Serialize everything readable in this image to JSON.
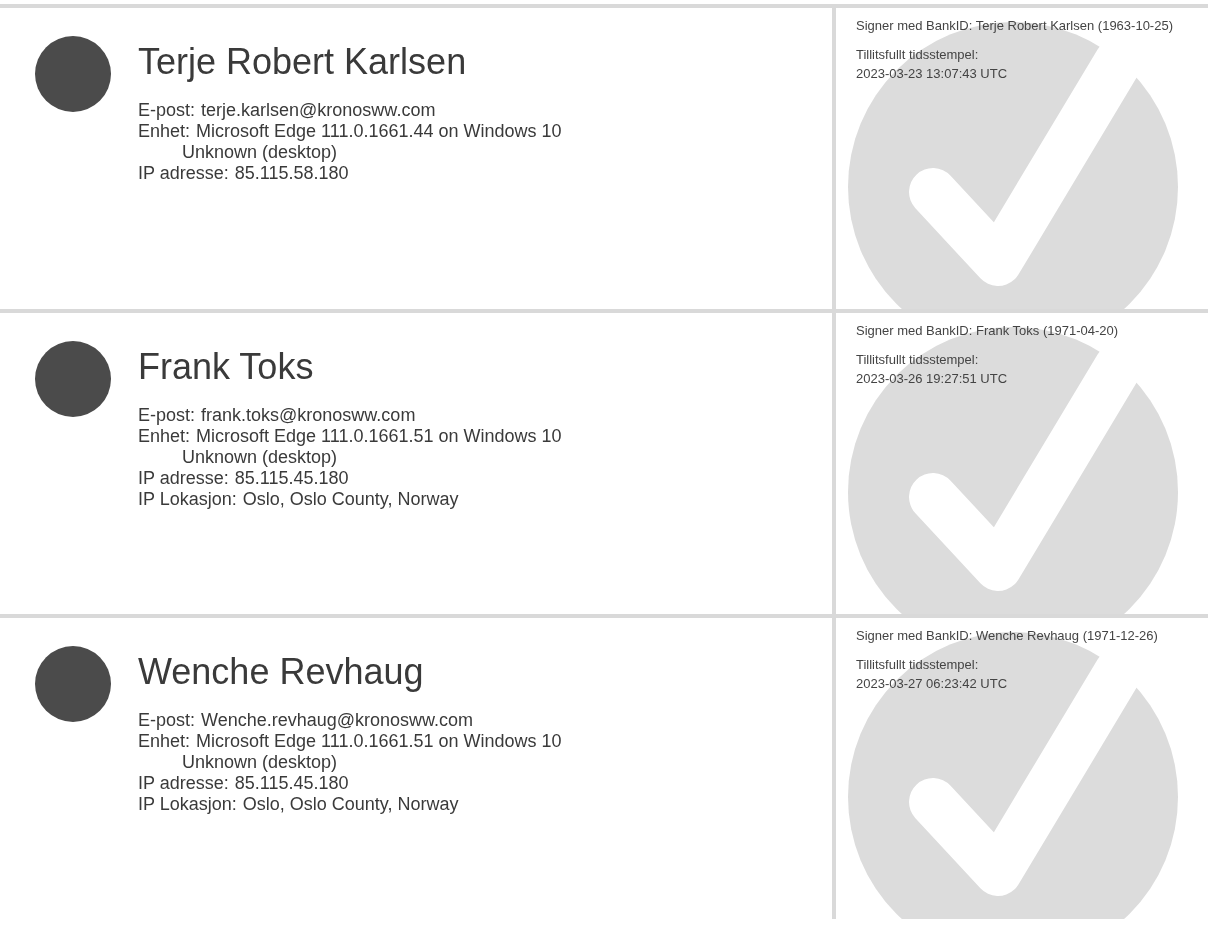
{
  "signers": [
    {
      "name": "Terje Robert Karlsen",
      "fields": [
        {
          "label": "E-post:",
          "value_lines": [
            "terje.karlsen@kronosww.com"
          ]
        },
        {
          "label": "Enhet:",
          "value_lines": [
            "Microsoft Edge 111.0.1661.44 on Windows 10",
            "Unknown (desktop)"
          ]
        },
        {
          "label": "IP adresse:",
          "value_lines": [
            "85.115.58.180"
          ]
        }
      ],
      "signature": "Signer med BankID: Terje Robert Karlsen (1963-10-25)",
      "timestamp_label": "Tillitsfullt tidsstempel:",
      "timestamp": "2023-03-23 13:07:43 UTC"
    },
    {
      "name": "Frank Toks",
      "fields": [
        {
          "label": "E-post:",
          "value_lines": [
            "frank.toks@kronosww.com"
          ]
        },
        {
          "label": "Enhet:",
          "value_lines": [
            "Microsoft Edge 111.0.1661.51 on Windows 10",
            "Unknown (desktop)"
          ]
        },
        {
          "label": "IP adresse:",
          "value_lines": [
            "85.115.45.180"
          ]
        },
        {
          "label": "IP Lokasjon:",
          "value_lines": [
            "Oslo, Oslo County, Norway"
          ]
        }
      ],
      "signature": "Signer med BankID: Frank Toks (1971-04-20)",
      "timestamp_label": "Tillitsfullt tidsstempel:",
      "timestamp": "2023-03-26 19:27:51 UTC"
    },
    {
      "name": "Wenche Revhaug",
      "fields": [
        {
          "label": "E-post:",
          "value_lines": [
            "Wenche.revhaug@kronosww.com"
          ]
        },
        {
          "label": "Enhet:",
          "value_lines": [
            "Microsoft Edge 111.0.1661.51 on Windows 10",
            "Unknown (desktop)"
          ]
        },
        {
          "label": "IP adresse:",
          "value_lines": [
            "85.115.45.180"
          ]
        },
        {
          "label": "IP Lokasjon:",
          "value_lines": [
            "Oslo, Oslo County, Norway"
          ]
        }
      ],
      "signature": "Signer med BankID: Wenche Revhaug (1971-12-26)",
      "timestamp_label": "Tillitsfullt tidsstempel:",
      "timestamp": "2023-03-27 06:23:42 UTC"
    }
  ]
}
